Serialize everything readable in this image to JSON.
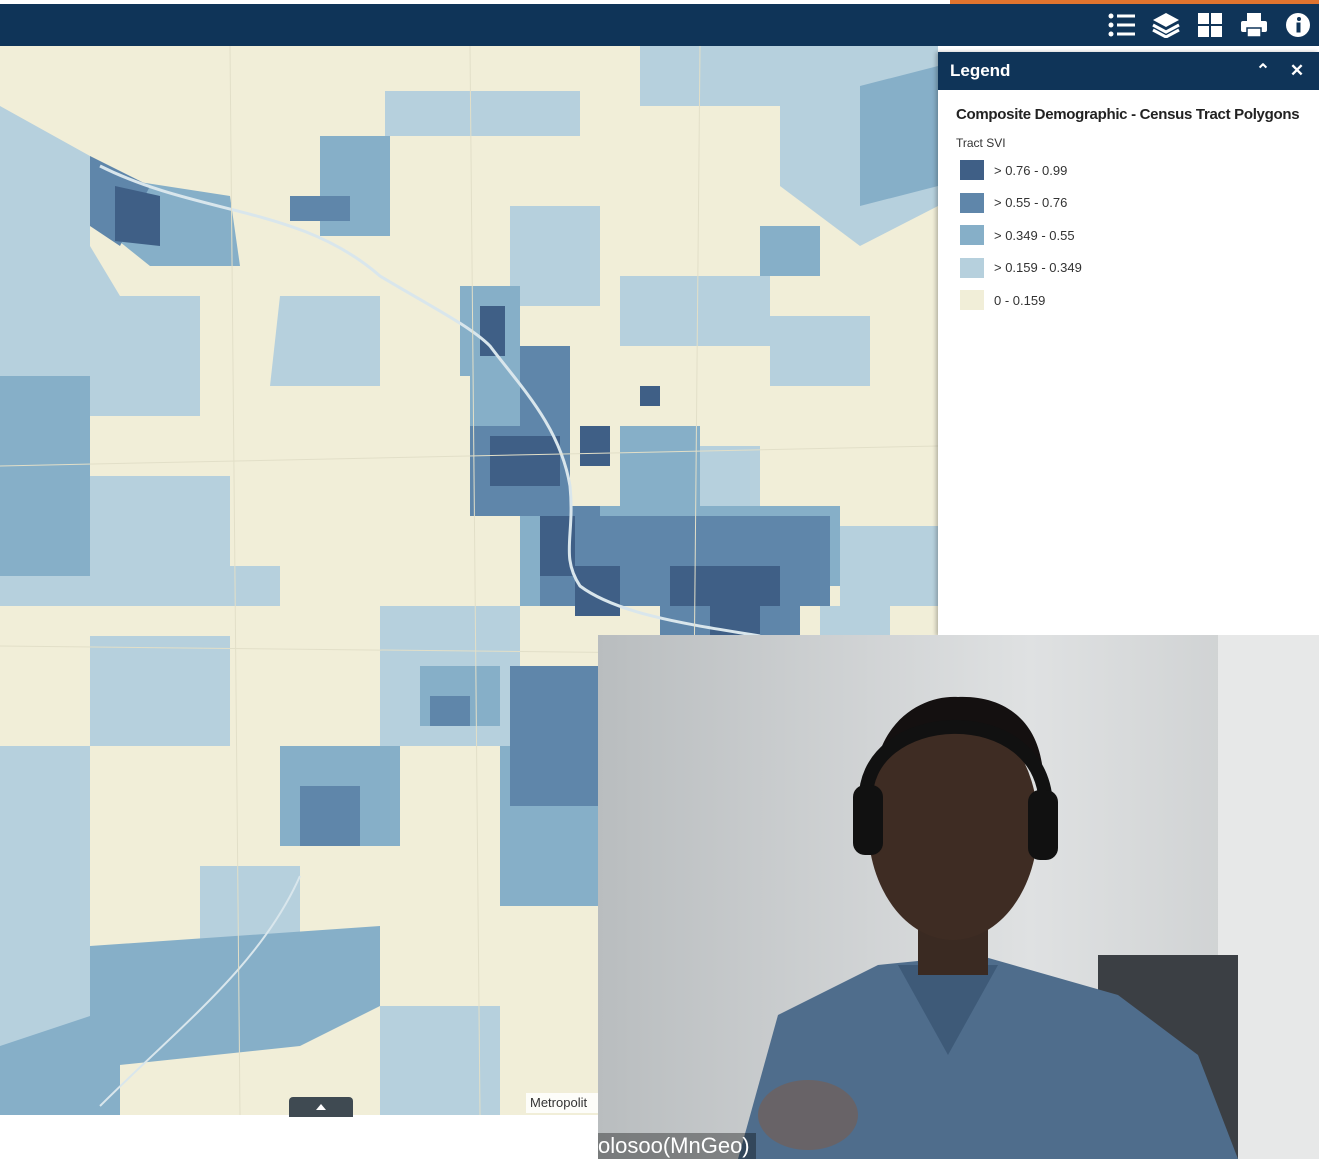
{
  "toolbar": {
    "icons": [
      "legend-list-icon",
      "layers-icon",
      "basemap-gallery-icon",
      "print-icon",
      "info-icon"
    ]
  },
  "legend": {
    "title": "Legend",
    "collapse_icon": "double-chevron-up-icon",
    "close_icon": "close-icon",
    "layer_title": "Composite Demographic - Census Tract Polygons",
    "field": "Tract SVI",
    "classes": [
      {
        "label": "> 0.76 - 0.99",
        "color": "#3f5f86"
      },
      {
        "label": "> 0.55 - 0.76",
        "color": "#5f86aa"
      },
      {
        "label": "> 0.349 - 0.55",
        "color": "#86afc8"
      },
      {
        "label": "> 0.159 - 0.349",
        "color": "#b6d0dd"
      },
      {
        "label": "0 - 0.159",
        "color": "#f1eed8"
      }
    ]
  },
  "map": {
    "attribution": "Metropolit",
    "colors": {
      "c1": "#3f5f86",
      "c2": "#5f86aa",
      "c3": "#86afc8",
      "c4": "#b6d0dd",
      "c5": "#f1eed8"
    }
  },
  "video": {
    "participant_name": "olosoo(MnGeo)"
  }
}
